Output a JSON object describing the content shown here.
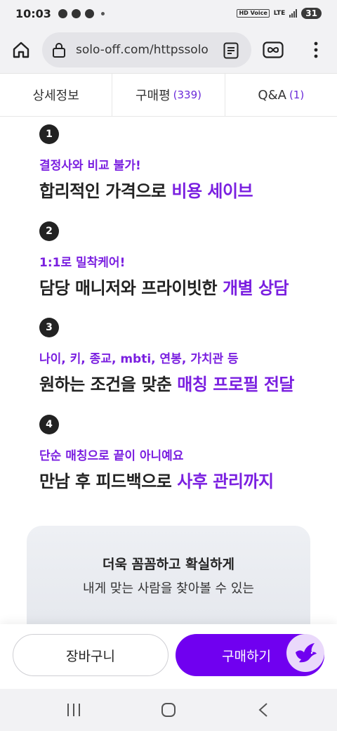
{
  "status_bar": {
    "time": "10:03",
    "network": "LTE",
    "hd_voice": "HD Voice",
    "battery": "31"
  },
  "browser": {
    "url": "solo-off.com/httpssolo",
    "icons": [
      "home-icon",
      "lock-icon",
      "reader-mode-icon",
      "infinity-icon",
      "more-vert-icon"
    ]
  },
  "tabs": [
    {
      "label": "상세정보",
      "count": ""
    },
    {
      "label": "구매평",
      "count": "(339)"
    },
    {
      "label": "Q&A",
      "count": "(1)"
    }
  ],
  "features": [
    {
      "number": "1",
      "sub": "결정사와 비교 불가!",
      "main_plain": "합리적인 가격으로 ",
      "main_highlight": "비용 세이브"
    },
    {
      "number": "2",
      "sub": "1:1로 밀착케어!",
      "main_plain": "담당 매니저와 프라이빗한 ",
      "main_highlight": "개별 상담"
    },
    {
      "number": "3",
      "sub": "나이, 키, 종교, mbti, 연봉, 가치관 등",
      "main_plain": "원하는 조건을 맞춘 ",
      "main_highlight": "매칭 프로필 전달"
    },
    {
      "number": "4",
      "sub": "단순 매칭으로 끝이 아니예요",
      "main_plain": "만남 후 피드백으로 ",
      "main_highlight": "사후 관리까지"
    }
  ],
  "promo": {
    "line1": "더욱 꼼꼼하고 확실하게",
    "line2": "내게 맞는 사람을 찾아볼 수 있는"
  },
  "actions": {
    "cart_label": "장바구니",
    "buy_label": "구매하기"
  },
  "colors": {
    "accent": "#7a1fe0",
    "button": "#7000f0",
    "badge_bg": "#ead9fb"
  }
}
